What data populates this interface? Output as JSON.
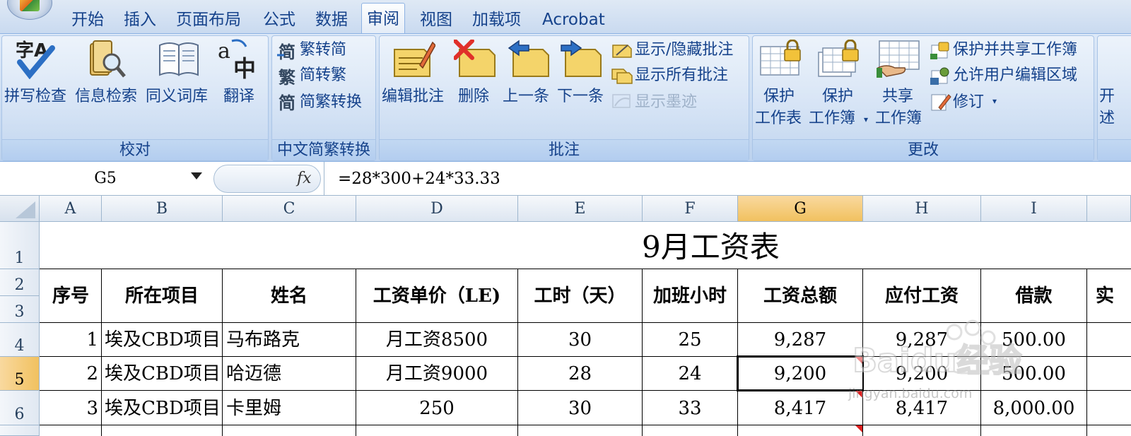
{
  "ribbon": {
    "tabs": [
      "开始",
      "插入",
      "页面布局",
      "公式",
      "数据",
      "审阅",
      "视图",
      "加载项",
      "Acrobat"
    ],
    "active_tab": "审阅",
    "groups": {
      "proofing": {
        "label": "校对",
        "buttons": [
          "拼写检查",
          "信息检索",
          "同义词库",
          "翻译"
        ]
      },
      "chinese": {
        "label": "中文简繁转换",
        "buttons": [
          "繁转简",
          "简转繁",
          "简繁转换"
        ]
      },
      "comments": {
        "label": "批注",
        "buttons": [
          "编辑批注",
          "删除",
          "上一条",
          "下一条"
        ],
        "small": [
          "显示/隐藏批注",
          "显示所有批注",
          "显示墨迹"
        ]
      },
      "changes": {
        "label": "更改",
        "protect_sheet": [
          "保护",
          "工作表"
        ],
        "protect_workbook": [
          "保护",
          "工作簿"
        ],
        "share_workbook": [
          "共享",
          "工作簿"
        ],
        "small": [
          "保护并共享工作簿",
          "允许用户编辑区域",
          "修订"
        ]
      },
      "partial": [
        "开",
        "述"
      ]
    }
  },
  "formula_bar": {
    "name_box": "G5",
    "fx": "fx",
    "formula": "=28*300+24*33.33"
  },
  "sheet": {
    "columns": [
      "A",
      "B",
      "C",
      "D",
      "E",
      "F",
      "G",
      "H",
      "I"
    ],
    "selected_column": "G",
    "rows": [
      "1",
      "2",
      "3",
      "4",
      "5",
      "6"
    ],
    "selected_row": "5",
    "title": "9月工资表",
    "headers": [
      "序号",
      "所在项目",
      "姓名",
      "工资单价（LE)",
      "工时（天）",
      "加班小时",
      "工资总额",
      "应付工资",
      "借款",
      "实"
    ],
    "data": [
      [
        "1",
        "埃及CBD项目",
        "马布路克",
        "月工资8500",
        "30",
        "25",
        "9,287",
        "9,287",
        "500.00"
      ],
      [
        "2",
        "埃及CBD项目",
        "哈迈德",
        "月工资9000",
        "28",
        "24",
        "9,200",
        "9,200",
        "500.00"
      ],
      [
        "3",
        "埃及CBD项目",
        "卡里姆",
        "250",
        "30",
        "33",
        "8,417",
        "8,417",
        "8,000.00"
      ]
    ]
  },
  "watermark": {
    "brand": "Baidu经验",
    "url": "jingyan.baidu.com"
  }
}
